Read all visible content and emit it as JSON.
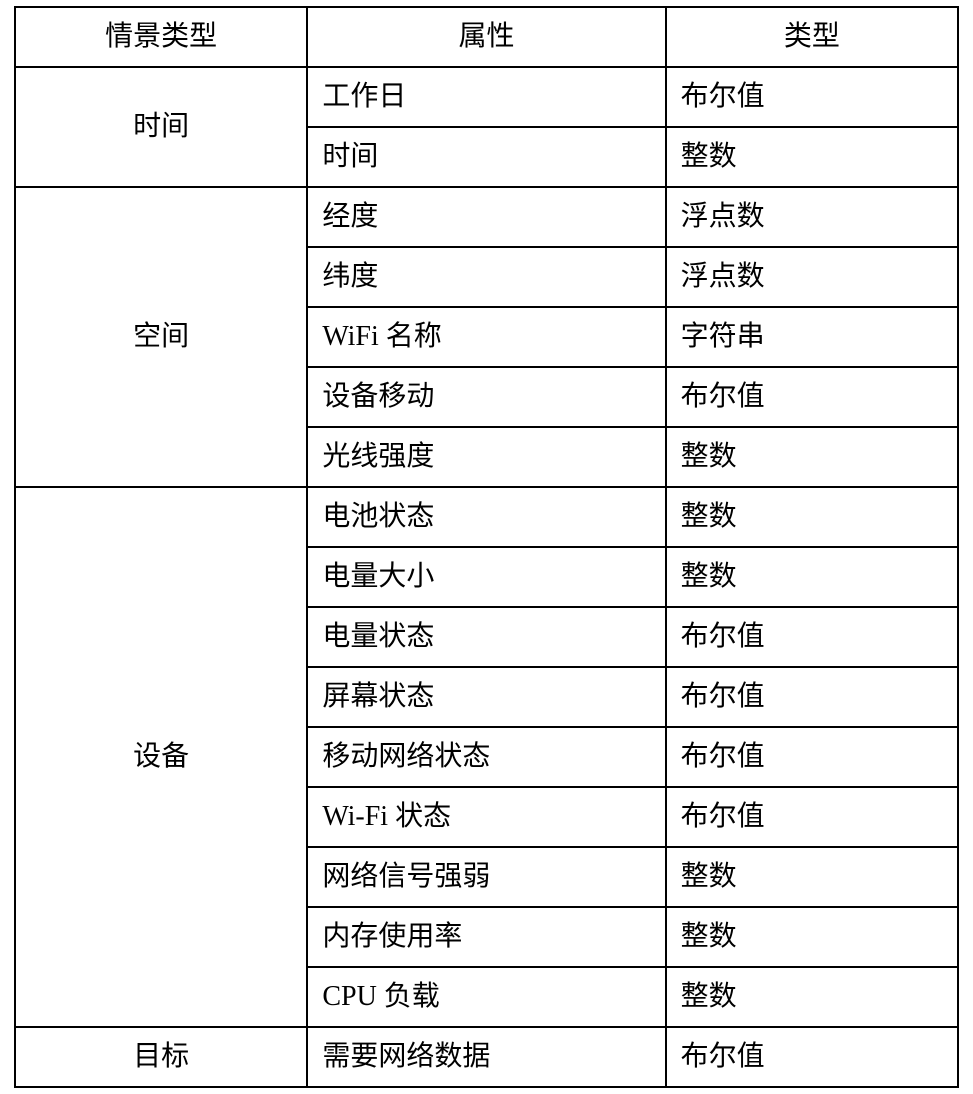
{
  "headers": {
    "category": "情景类型",
    "attribute": "属性",
    "type": "类型"
  },
  "groups": [
    {
      "category": "时间",
      "rows": [
        {
          "attribute": "工作日",
          "type": "布尔值"
        },
        {
          "attribute": "时间",
          "type": "整数"
        }
      ]
    },
    {
      "category": "空间",
      "rows": [
        {
          "attribute": "经度",
          "type": "浮点数"
        },
        {
          "attribute": "纬度",
          "type": "浮点数"
        },
        {
          "attribute": "WiFi 名称",
          "type": "字符串"
        },
        {
          "attribute": "设备移动",
          "type": "布尔值"
        },
        {
          "attribute": "光线强度",
          "type": "整数"
        }
      ]
    },
    {
      "category": "设备",
      "rows": [
        {
          "attribute": "电池状态",
          "type": "整数"
        },
        {
          "attribute": "电量大小",
          "type": "整数"
        },
        {
          "attribute": "电量状态",
          "type": "布尔值"
        },
        {
          "attribute": "屏幕状态",
          "type": "布尔值"
        },
        {
          "attribute": "移动网络状态",
          "type": "布尔值"
        },
        {
          "attribute": "Wi-Fi 状态",
          "type": "布尔值"
        },
        {
          "attribute": "网络信号强弱",
          "type": "整数"
        },
        {
          "attribute": "内存使用率",
          "type": "整数"
        },
        {
          "attribute": "CPU 负载",
          "type": "整数"
        }
      ]
    },
    {
      "category": "目标",
      "rows": [
        {
          "attribute": "需要网络数据",
          "type": "布尔值"
        }
      ]
    }
  ]
}
